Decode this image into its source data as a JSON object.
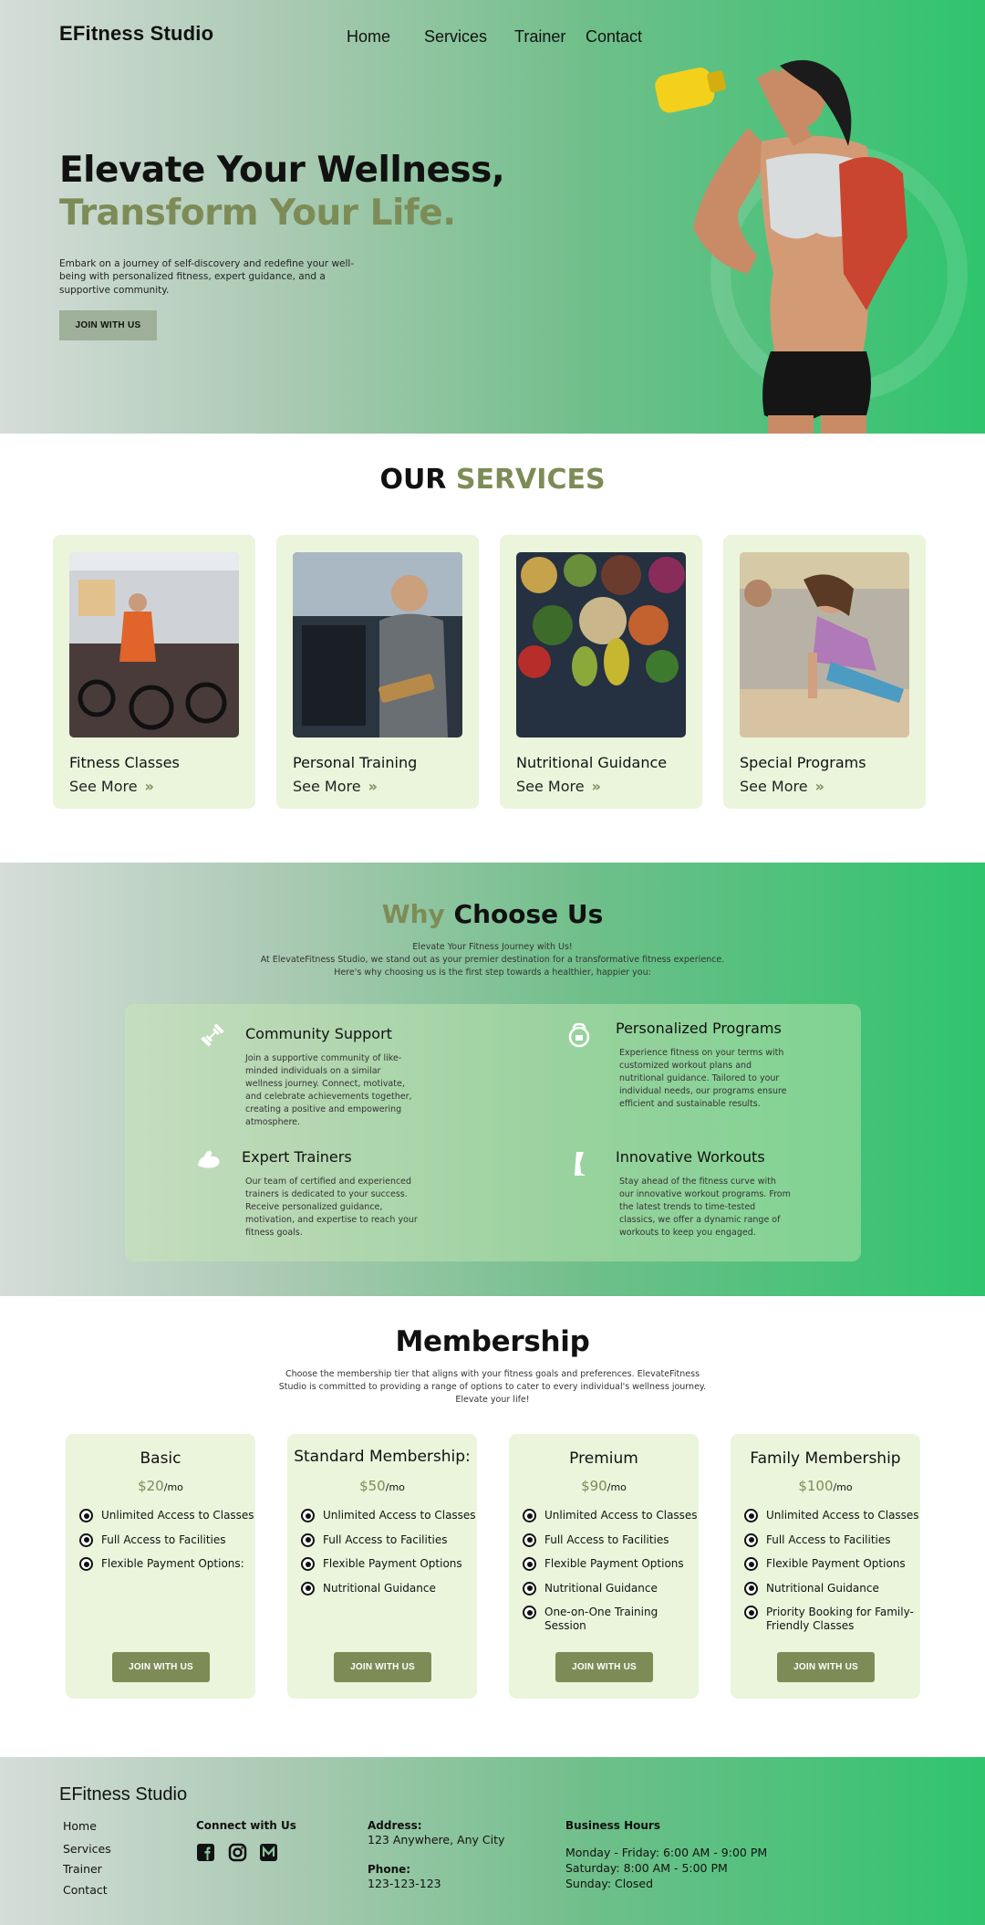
{
  "header": {
    "brand": "EFitness Studio",
    "nav": [
      "Home",
      "Services",
      "Trainer",
      "Contact"
    ]
  },
  "hero": {
    "title_line1": "Elevate Your Wellness,",
    "title_line2": "Transform Your Life.",
    "description": "Embark on a journey of self-discovery and redefine your well-being with personalized fitness, expert guidance, and a supportive community.",
    "cta": "JOIN WITH US"
  },
  "services": {
    "title_plain": "OUR",
    "title_accent": "SERVICES",
    "items": [
      {
        "name": "Fitness Classes",
        "more": "See More"
      },
      {
        "name": "Personal Training",
        "more": "See More"
      },
      {
        "name": "Nutritional Guidance",
        "more": "See More"
      },
      {
        "name": "Special Programs",
        "more": "See More"
      }
    ]
  },
  "why": {
    "title_accent": "Why",
    "title_plain": "Choose Us",
    "subtitle_1": "Elevate Your Fitness Journey with Us!",
    "subtitle_2": "At ElevateFitness Studio, we stand out as your premier destination for a transformative fitness experience.",
    "subtitle_3": "Here's why choosing us is the first step towards a healthier, happier you:",
    "features": [
      {
        "title": "Community Support",
        "icon": "dumbbell-icon",
        "text": "Join a supportive community of like-minded individuals on a similar wellness journey. Connect, motivate, and celebrate achievements together, creating a positive and empowering atmosphere."
      },
      {
        "title": "Personalized Programs",
        "icon": "kettlebell-icon",
        "text": "Experience fitness on your terms with customized workout plans and nutritional guidance. Tailored to your individual needs, our programs ensure efficient and sustainable results."
      },
      {
        "title": "Expert Trainers",
        "icon": "flexed-arm-icon",
        "text": "Our team of certified and experienced trainers is dedicated to your success. Receive personalized guidance, motivation, and expertise to reach your fitness goals."
      },
      {
        "title": "Innovative Workouts",
        "icon": "leg-icon",
        "text": "Stay ahead of the fitness curve with our innovative workout programs. From the latest trends to time-tested classics, we offer a dynamic range of workouts to keep you engaged."
      }
    ]
  },
  "membership": {
    "title": "Membership",
    "subtitle": "Choose the membership tier that aligns with your fitness goals and preferences. ElevateFitness Studio is committed to providing a range of options to cater to every individual's wellness journey. Elevate your life!",
    "unit": "/mo",
    "cta": "JOIN WITH US",
    "plans": [
      {
        "name": "Basic",
        "price": "$20",
        "features": [
          "Unlimited Access to Classes",
          "Full Access to Facilities",
          "Flexible Payment Options:"
        ]
      },
      {
        "name": "Standard Membership:",
        "price": "$50",
        "features": [
          "Unlimited Access to Classes",
          "Full Access to Facilities",
          "Flexible Payment Options",
          "Nutritional Guidance"
        ]
      },
      {
        "name": "Premium",
        "price": "$90",
        "features": [
          "Unlimited Access to Classes",
          "Full Access to Facilities",
          "Flexible Payment Options",
          "Nutritional Guidance",
          "One-on-One Training Session"
        ]
      },
      {
        "name": "Family Membership",
        "price": "$100",
        "features": [
          "Unlimited Access to Classes",
          "Full Access to Facilities",
          "Flexible Payment Options",
          "Nutritional Guidance",
          "Priority Booking for Family-Friendly Classes"
        ]
      }
    ]
  },
  "footer": {
    "brand": "EFitness Studio",
    "links": [
      "Home",
      "Services",
      "Trainer",
      "Contact"
    ],
    "connect_title": "Connect with Us",
    "social_icons": [
      "facebook-icon",
      "instagram-icon",
      "medium-icon"
    ],
    "address_label": "Address:",
    "address": "123 Anywhere, Any City",
    "phone_label": "Phone:",
    "phone": "123-123-123",
    "hours_title": "Business Hours",
    "hours": [
      "Monday - Friday: 6:00 AM - 9:00 PM",
      "Saturday: 8:00 AM - 5:00 PM",
      "Sunday: Closed"
    ]
  },
  "colors": {
    "accent": "#7d8c57",
    "card_bg": "#eaf5dc",
    "gradient_end": "#2fc46e"
  }
}
